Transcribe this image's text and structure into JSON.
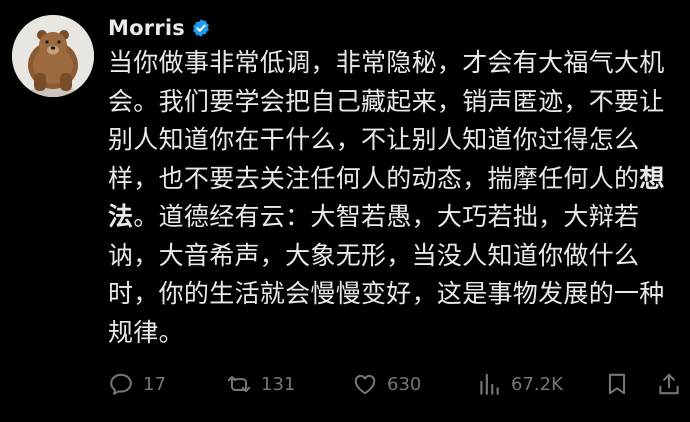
{
  "author": {
    "name": "Morris",
    "verified": true,
    "avatar_icon": "bear-avatar-icon"
  },
  "tweet": {
    "text_part1": "当你做事非常低调，非常隐秘，才会有大福气大机会。我们要学会把自己藏起来，销声匿迹，不要让别人知道你在干什么，不让别人知道你过得怎么样，也不要去关注任何人的动态，揣摩任何人的",
    "text_bold": "想法",
    "text_part2": "。道德经有云：大智若愚，大巧若拙，大辩若讷，大音希声，大象无形，当没人知道你做什么时，你的生活就会慢慢变好，这是事物发展的一种规律。"
  },
  "actions": {
    "replies": "17",
    "reposts": "131",
    "likes": "630",
    "views": "67.2K"
  },
  "colors": {
    "accent": "#1d9bf0",
    "muted": "#71767b",
    "text": "#e7e9ea",
    "background": "#000000"
  }
}
